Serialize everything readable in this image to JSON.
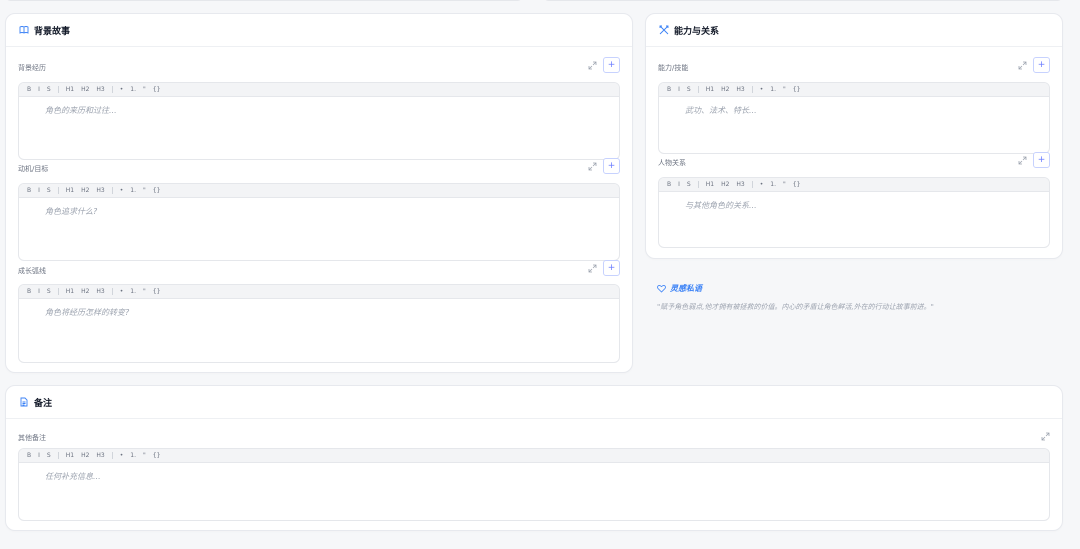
{
  "toolbar": [
    "B",
    "I",
    "S",
    "H1",
    "H2",
    "H3",
    "•",
    "1.",
    "\"",
    "{}"
  ],
  "backstory": {
    "title": "背景故事",
    "sections": [
      {
        "label": "背景经历",
        "placeholder": "角色的来历和过往..."
      },
      {
        "label": "动机/目标",
        "placeholder": "角色追求什么?"
      },
      {
        "label": "成长弧线",
        "placeholder": "角色将经历怎样的转变?"
      }
    ]
  },
  "abilities": {
    "title": "能力与关系",
    "sections": [
      {
        "label": "能力/技能",
        "placeholder": "武功、法术、特长..."
      },
      {
        "label": "人物关系",
        "placeholder": "与其他角色的关系..."
      }
    ]
  },
  "inspiration": {
    "title": "灵感私语",
    "text": "\"赋予角色弱点,他才拥有被拯救的价值。内心的矛盾让角色鲜活,外在的行动让故事前进。\""
  },
  "notes": {
    "title": "备注",
    "label": "其他备注",
    "placeholder": "任何补充信息..."
  },
  "icons": {
    "backstory": "book-icon",
    "abilities": "sword-icon",
    "inspiration": "heart-icon",
    "notes": "document-icon",
    "expand": "expand-icon",
    "add": "plus-icon"
  },
  "colors": {
    "accent": "#3b82f6",
    "border": "#e5e7eb",
    "toolbar_bg": "#f3f4f6"
  }
}
